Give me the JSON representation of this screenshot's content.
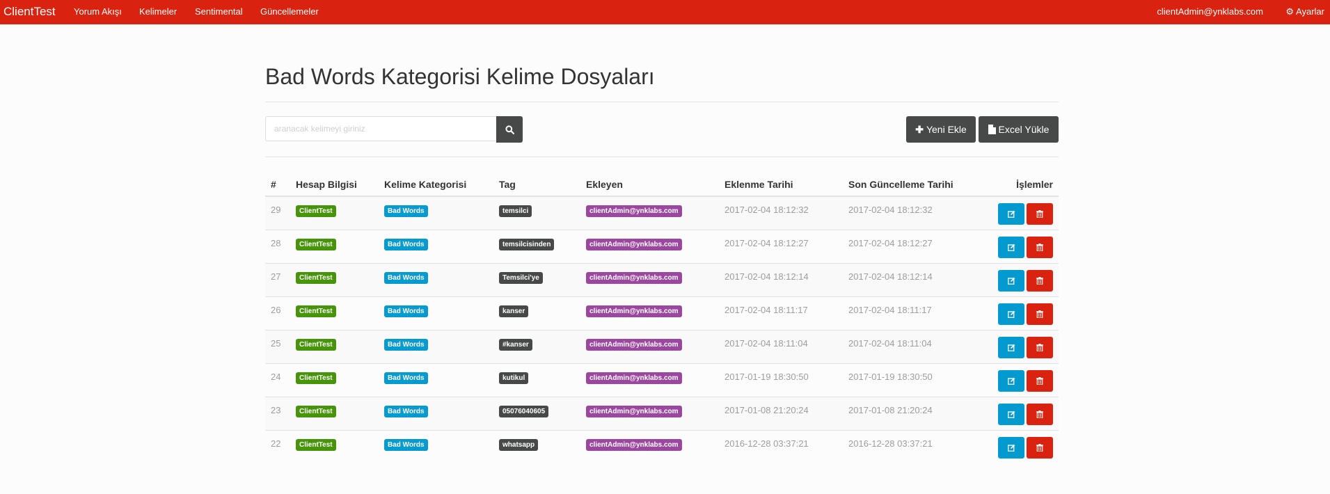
{
  "navbar": {
    "brand": "ClientTest",
    "links": [
      "Yorum Akışı",
      "Kelimeler",
      "Sentimental",
      "Güncellemeler"
    ],
    "user": "clientAdmin@ynklabs.com",
    "settings": "Ayarlar"
  },
  "page": {
    "title": "Bad Words Kategorisi Kelime Dosyaları"
  },
  "search": {
    "placeholder": "aranacak kelimeyi giriniz"
  },
  "actions": {
    "add": "Yeni Ekle",
    "upload": "Excel Yükle"
  },
  "table": {
    "headers": [
      "#",
      "Hesap Bilgisi",
      "Kelime Kategorisi",
      "Tag",
      "Ekleyen",
      "Eklenme Tarihi",
      "Son Güncelleme Tarihi",
      "İşlemler"
    ],
    "rows": [
      {
        "id": "29",
        "account": "ClientTest",
        "category": "Bad Words",
        "tag": "temsilci",
        "added_by": "clientAdmin@ynklabs.com",
        "created": "2017-02-04 18:12:32",
        "updated": "2017-02-04 18:12:32"
      },
      {
        "id": "28",
        "account": "ClientTest",
        "category": "Bad Words",
        "tag": "temsilcisinden",
        "added_by": "clientAdmin@ynklabs.com",
        "created": "2017-02-04 18:12:27",
        "updated": "2017-02-04 18:12:27"
      },
      {
        "id": "27",
        "account": "ClientTest",
        "category": "Bad Words",
        "tag": "Temsilci'ye",
        "added_by": "clientAdmin@ynklabs.com",
        "created": "2017-02-04 18:12:14",
        "updated": "2017-02-04 18:12:14"
      },
      {
        "id": "26",
        "account": "ClientTest",
        "category": "Bad Words",
        "tag": "kanser",
        "added_by": "clientAdmin@ynklabs.com",
        "created": "2017-02-04 18:11:17",
        "updated": "2017-02-04 18:11:17"
      },
      {
        "id": "25",
        "account": "ClientTest",
        "category": "Bad Words",
        "tag": "#kanser",
        "added_by": "clientAdmin@ynklabs.com",
        "created": "2017-02-04 18:11:04",
        "updated": "2017-02-04 18:11:04"
      },
      {
        "id": "24",
        "account": "ClientTest",
        "category": "Bad Words",
        "tag": "kutikul",
        "added_by": "clientAdmin@ynklabs.com",
        "created": "2017-01-19 18:30:50",
        "updated": "2017-01-19 18:30:50"
      },
      {
        "id": "23",
        "account": "ClientTest",
        "category": "Bad Words",
        "tag": "05076040605",
        "added_by": "clientAdmin@ynklabs.com",
        "created": "2017-01-08 21:20:24",
        "updated": "2017-01-08 21:20:24"
      },
      {
        "id": "22",
        "account": "ClientTest",
        "category": "Bad Words",
        "tag": "whatsapp",
        "added_by": "clientAdmin@ynklabs.com",
        "created": "2016-12-28 03:37:21",
        "updated": "2016-12-28 03:37:21"
      }
    ]
  },
  "icons": {
    "search": "search-icon",
    "add": "plus-icon",
    "upload": "file-icon",
    "edit": "edit-icon",
    "delete": "trash-icon",
    "settings": "gear-icon"
  },
  "colors": {
    "navbar": "#d9230f",
    "dark_button": "#474949",
    "edit_button": "#029acf",
    "delete_button": "#d9230f",
    "account_label": "#469408",
    "category_label": "#029acf",
    "tag_label": "#474949",
    "user_label": "#9b479f"
  }
}
